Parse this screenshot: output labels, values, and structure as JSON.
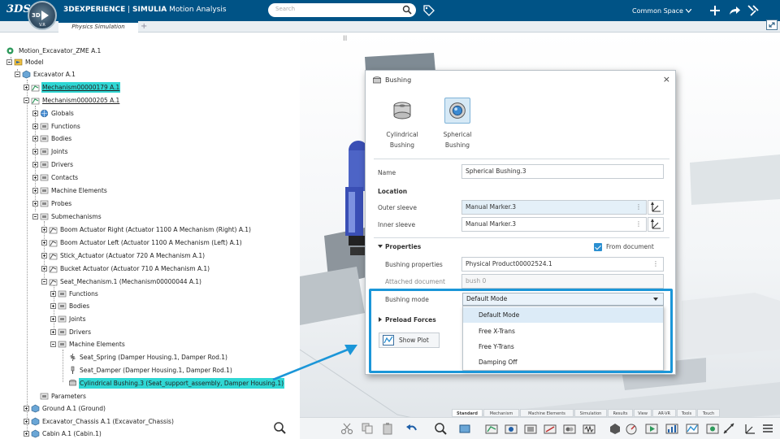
{
  "app": {
    "brand": "3DEXPERIENCE",
    "separator": " | ",
    "product": "SIMULIA",
    "module": "Motion Analysis",
    "compass_label": "3D",
    "compass_version": "V.R",
    "logo": "3DS"
  },
  "search": {
    "placeholder": "Search"
  },
  "space": {
    "label": "Common Space"
  },
  "tabs": [
    {
      "label": "Physics Simulation"
    }
  ],
  "tab_add": "+",
  "tree": {
    "root": "Motion_Excavator_ZME A.1",
    "model": "Model",
    "excavator": "Excavator A.1",
    "mech179": "Mechanism00000179 A.1",
    "mech205": "Mechanism00000205 A.1",
    "globals": "Globals",
    "functions": "Functions",
    "bodies": "Bodies",
    "joints": "Joints",
    "drivers": "Drivers",
    "contacts": "Contacts",
    "machine_elements": "Machine Elements",
    "probes": "Probes",
    "submechanisms": "Submechanisms",
    "sub1": "Boom Actuator Right (Actuator 1100 A Mechanism (Right) A.1)",
    "sub2": "Boom Actuator Left (Actuator 1100 A Mechanism (Left) A.1)",
    "sub3": "Stick_Actuator (Actuator 720 A Mechanism A.1)",
    "sub4": "Bucket Actuator (Actuator 710 A Mechanism A.1)",
    "seat": "Seat_Mechanism.1 (Mechanism00000044 A.1)",
    "seat_functions": "Functions",
    "seat_bodies": "Bodies",
    "seat_joints": "Joints",
    "seat_drivers": "Drivers",
    "seat_machine_elements": "Machine Elements",
    "seat_spring": "Seat_Spring (Damper Housing.1, Damper Rod.1)",
    "seat_damper": "Seat_Damper (Damper Housing.1, Damper Rod.1)",
    "cyl_bushing": "Cylindrical Bushing.3 (Seat_support_assembly, Damper Housing.1)",
    "parameters": "Parameters",
    "ground": "Ground A.1 (Ground)",
    "chassis": "Excavator_Chassis A.1 (Excavator_Chassis)",
    "cabin": "Cabin A.1 (Cabin.1)"
  },
  "dialog": {
    "title": "Bushing",
    "close": "×",
    "type_cyl_line1": "Cylindrical",
    "type_cyl_line2": "Bushing",
    "type_sph_line1": "Spherical",
    "type_sph_line2": "Bushing",
    "name_label": "Name",
    "name_value": "Spherical Bushing.3",
    "location_label": "Location",
    "outer_label": "Outer sleeve",
    "outer_value": "Manual Marker.3",
    "inner_label": "Inner sleeve",
    "inner_value": "Manual Marker.3",
    "properties_label": "Properties",
    "from_document": "From document",
    "bushing_props_label": "Bushing properties",
    "bushing_props_value": "Physical Product00002524.1",
    "attached_label": "Attached document",
    "attached_value": "bush 0",
    "mode_label": "Bushing mode",
    "mode_value": "Default Mode",
    "mode_options": [
      "Default Mode",
      "Free X-Trans",
      "Free Y-Trans",
      "Damping Off"
    ],
    "preload_label": "Preload Forces",
    "show_plot": "Show Plot",
    "dots": "⋮"
  },
  "bottom_tabs": [
    "Standard",
    "Mechanism",
    "Machine Elements",
    "Simulation",
    "Results",
    "View",
    "AR-VR",
    "Tools",
    "Touch"
  ],
  "colors": {
    "topbar": "#005386",
    "highlight": "#2fd7d4",
    "callout": "#1b96d8",
    "accent": "#2a8fd1"
  }
}
